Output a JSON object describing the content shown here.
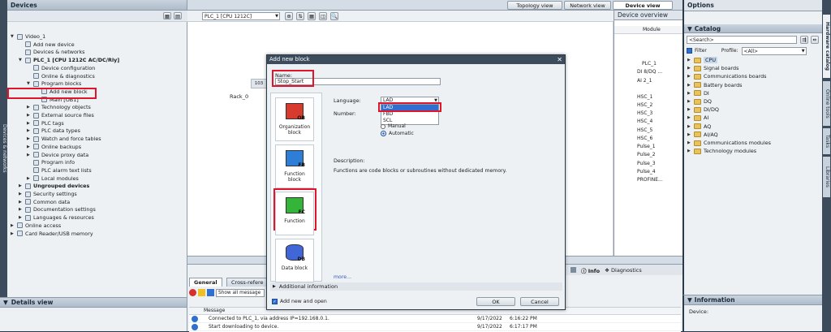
{
  "left_panel": {
    "title": "Devices",
    "vertical_tab": "Devices & networks",
    "tree": [
      {
        "label": "Video_1",
        "indent": 0,
        "arrow": "▼"
      },
      {
        "label": "Add new device",
        "indent": 1,
        "arrow": ""
      },
      {
        "label": "Devices & networks",
        "indent": 1,
        "arrow": ""
      },
      {
        "label": "PLC_1 [CPU 1212C AC/DC/Rly]",
        "indent": 1,
        "arrow": "▼",
        "bold": true
      },
      {
        "label": "Device configuration",
        "indent": 2,
        "arrow": ""
      },
      {
        "label": "Online & diagnostics",
        "indent": 2,
        "arrow": ""
      },
      {
        "label": "Program blocks",
        "indent": 2,
        "arrow": "▼"
      },
      {
        "label": "Add new block",
        "indent": 3,
        "arrow": ""
      },
      {
        "label": "Main [OB1]",
        "indent": 3,
        "arrow": ""
      },
      {
        "label": "Technology objects",
        "indent": 2,
        "arrow": "▶"
      },
      {
        "label": "External source files",
        "indent": 2,
        "arrow": "▶"
      },
      {
        "label": "PLC tags",
        "indent": 2,
        "arrow": "▶"
      },
      {
        "label": "PLC data types",
        "indent": 2,
        "arrow": "▶"
      },
      {
        "label": "Watch and force tables",
        "indent": 2,
        "arrow": "▶"
      },
      {
        "label": "Online backups",
        "indent": 2,
        "arrow": "▶"
      },
      {
        "label": "Device proxy data",
        "indent": 2,
        "arrow": "▶"
      },
      {
        "label": "Program info",
        "indent": 2,
        "arrow": ""
      },
      {
        "label": "PLC alarm text lists",
        "indent": 2,
        "arrow": ""
      },
      {
        "label": "Local modules",
        "indent": 2,
        "arrow": "▶"
      },
      {
        "label": "Ungrouped devices",
        "indent": 1,
        "arrow": "▶",
        "bold": true
      },
      {
        "label": "Security settings",
        "indent": 1,
        "arrow": "▶"
      },
      {
        "label": "Common data",
        "indent": 1,
        "arrow": "▶"
      },
      {
        "label": "Documentation settings",
        "indent": 1,
        "arrow": "▶"
      },
      {
        "label": "Languages & resources",
        "indent": 1,
        "arrow": "▶"
      },
      {
        "label": "Online access",
        "indent": 0,
        "arrow": "▶"
      },
      {
        "label": "Card Reader/USB memory",
        "indent": 0,
        "arrow": "▶"
      }
    ],
    "details_view": "Details view"
  },
  "toolbar": {
    "device_select": "PLC_1 [CPU 1212C]",
    "topology_view": "Topology view",
    "network_view": "Network view",
    "device_view": "Device view"
  },
  "canvas": {
    "rack_label": "Rack_0",
    "slot_label": "103"
  },
  "device_overview": {
    "title": "Device overview",
    "module_header": "Module",
    "rows": [
      "PLC_1",
      "DI 8/DQ ...",
      "AI 2_1",
      "HSC_1",
      "HSC_2",
      "HSC_3",
      "HSC_4",
      "HSC_5",
      "HSC_6",
      "Pulse_1",
      "Pulse_2",
      "Pulse_3",
      "Pulse_4",
      "PROFINE..."
    ]
  },
  "dialog": {
    "title": "Add new block",
    "name_label": "Name:",
    "name_value": "Stop_Start",
    "blocks": [
      {
        "label": "Organization block",
        "code": "OB",
        "color": "#d83a2e"
      },
      {
        "label": "Function block",
        "code": "FB",
        "color": "#2e7dd6"
      },
      {
        "label": "Function",
        "code": "FC",
        "color": "#35b43a"
      },
      {
        "label": "Data block",
        "code": "DB",
        "color": "#4066d8"
      }
    ],
    "language_label": "Language:",
    "language_value": "LAD",
    "language_options": [
      "LAD",
      "FBD",
      "SCL"
    ],
    "number_label": "Number:",
    "manual_label": "Manual",
    "automatic_label": "Automatic",
    "description_label": "Description:",
    "description_text": "Functions are code blocks or subroutines without dedicated memory.",
    "more_link": "more...",
    "additional_info": "Additional information",
    "add_new_open": "Add new and open",
    "ok": "OK",
    "cancel": "Cancel"
  },
  "bottom": {
    "tabs": [
      "General",
      "Cross-refere"
    ],
    "show_all": "Show all message",
    "message_header": "Message",
    "messages": [
      {
        "text": "Connected to PLC_1, via address IP=192.168.0.1.",
        "date": "9/17/2022",
        "time": "6:16:22 PM"
      },
      {
        "text": "Start downloading to device.",
        "date": "9/17/2022",
        "time": "6:17:17 PM"
      }
    ],
    "info_tab": "Info",
    "diagnostics_tab": "Diagnostics"
  },
  "right_panel": {
    "title": "Options",
    "catalog": "Catalog",
    "search_placeholder": "<Search>",
    "filter_label": "Filter",
    "profile_label": "Profile:",
    "profile_value": "<All>",
    "items": [
      "CPU",
      "Signal boards",
      "Communications boards",
      "Battery boards",
      "DI",
      "DQ",
      "DI/DQ",
      "AI",
      "AQ",
      "AI/AQ",
      "Communications modules",
      "Technology modules"
    ],
    "side_tabs": [
      "Hardware catalog",
      "Online tools",
      "Tasks",
      "Libraries"
    ],
    "information": "Information",
    "device_label": "Device:"
  }
}
